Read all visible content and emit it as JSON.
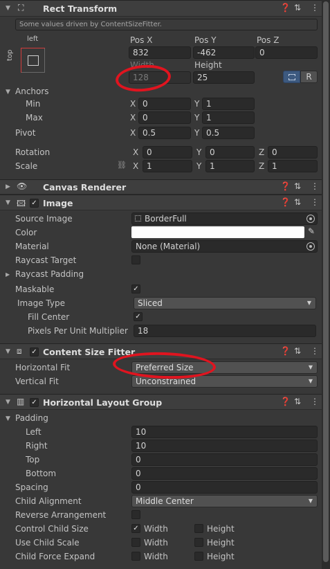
{
  "rect": {
    "title": "Rect Transform",
    "note": "Some values driven by ContentSizeFitter.",
    "anchor_h": "left",
    "anchor_v": "top",
    "posx_label": "Pos X",
    "posy_label": "Pos Y",
    "posz_label": "Pos Z",
    "posx": "832",
    "posy": "-462",
    "posz": "0",
    "width_label": "Width",
    "height_label": "Height",
    "width": "128",
    "height": "25",
    "r_button": "R",
    "anchors_label": "Anchors",
    "min_label": "Min",
    "max_label": "Max",
    "pivot_label": "Pivot",
    "min_x": "0",
    "min_y": "1",
    "max_x": "0",
    "max_y": "1",
    "pivot_x": "0.5",
    "pivot_y": "0.5",
    "rotation_label": "Rotation",
    "scale_label": "Scale",
    "rot_x": "0",
    "rot_y": "0",
    "rot_z": "0",
    "scale_x": "1",
    "scale_y": "1",
    "scale_z": "1"
  },
  "axis": {
    "x": "X",
    "y": "Y",
    "z": "Z"
  },
  "canvas_renderer": {
    "title": "Canvas Renderer"
  },
  "image": {
    "title": "Image",
    "source_label": "Source Image",
    "source_value": "BorderFull",
    "color_label": "Color",
    "color_value": "#ffffff",
    "material_label": "Material",
    "material_value": "None (Material)",
    "raycast_target_label": "Raycast Target",
    "raycast_padding_label": "Raycast Padding",
    "maskable_label": "Maskable",
    "image_type_label": "Image Type",
    "image_type_value": "Sliced",
    "fill_center_label": "Fill Center",
    "ppu_label": "Pixels Per Unit Multiplier",
    "ppu_value": "18"
  },
  "csf": {
    "title": "Content Size Fitter",
    "hfit_label": "Horizontal Fit",
    "hfit_value": "Preferred Size",
    "vfit_label": "Vertical Fit",
    "vfit_value": "Unconstrained"
  },
  "hlg": {
    "title": "Horizontal Layout Group",
    "padding_label": "Padding",
    "left_label": "Left",
    "left_value": "10",
    "right_label": "Right",
    "right_value": "10",
    "top_label": "Top",
    "top_value": "0",
    "bottom_label": "Bottom",
    "bottom_value": "0",
    "spacing_label": "Spacing",
    "spacing_value": "0",
    "alignment_label": "Child Alignment",
    "alignment_value": "Middle Center",
    "reverse_label": "Reverse Arrangement",
    "control_label": "Control Child Size",
    "usescale_label": "Use Child Scale",
    "expand_label": "Child Force Expand",
    "width_opt": "Width",
    "height_opt": "Height"
  },
  "colors": {
    "highlight": "#e0141f",
    "accent": "#3d5a80"
  }
}
